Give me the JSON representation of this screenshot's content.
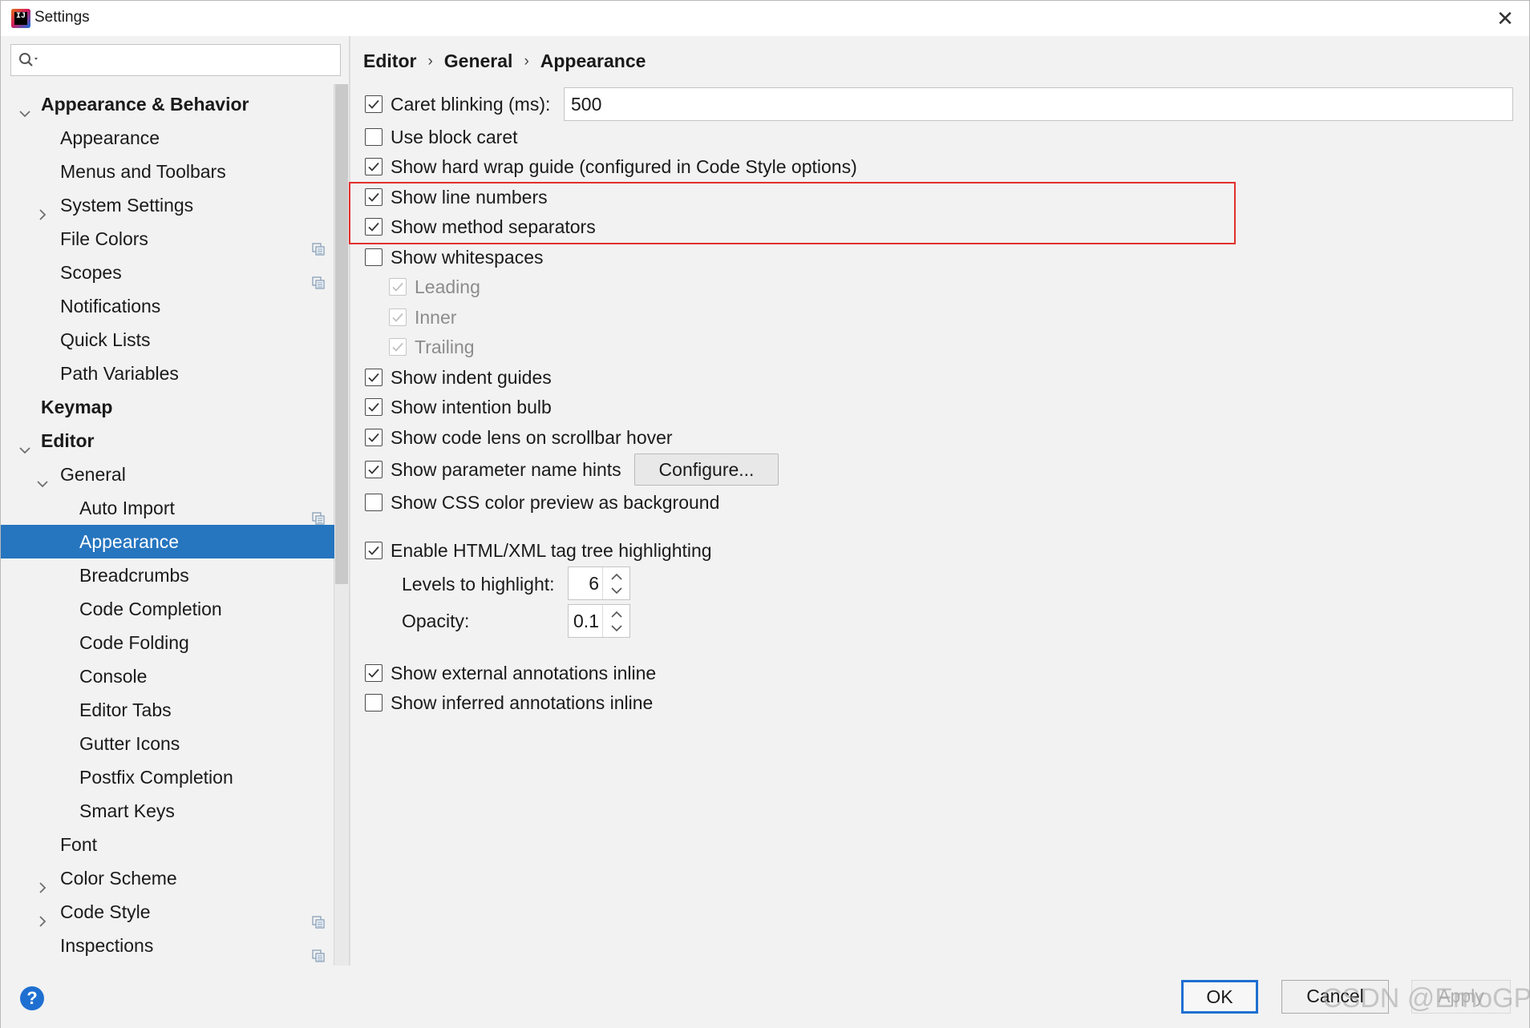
{
  "window": {
    "title": "Settings",
    "close_glyph": "✕",
    "app_icon_letters": "IJ"
  },
  "sidebar": {
    "search_placeholder": "",
    "items": [
      {
        "label": "Appearance & Behavior",
        "indent": 0,
        "bold": true,
        "arrow": "down",
        "project_icon": false
      },
      {
        "label": "Appearance",
        "indent": 1,
        "bold": false,
        "arrow": "none",
        "project_icon": false
      },
      {
        "label": "Menus and Toolbars",
        "indent": 1,
        "bold": false,
        "arrow": "none",
        "project_icon": false
      },
      {
        "label": "System Settings",
        "indent": 1,
        "bold": false,
        "arrow": "right",
        "project_icon": false
      },
      {
        "label": "File Colors",
        "indent": 1,
        "bold": false,
        "arrow": "none",
        "project_icon": true
      },
      {
        "label": "Scopes",
        "indent": 1,
        "bold": false,
        "arrow": "none",
        "project_icon": true
      },
      {
        "label": "Notifications",
        "indent": 1,
        "bold": false,
        "arrow": "none",
        "project_icon": false
      },
      {
        "label": "Quick Lists",
        "indent": 1,
        "bold": false,
        "arrow": "none",
        "project_icon": false
      },
      {
        "label": "Path Variables",
        "indent": 1,
        "bold": false,
        "arrow": "none",
        "project_icon": false
      },
      {
        "label": "Keymap",
        "indent": 0,
        "bold": true,
        "arrow": "none",
        "project_icon": false
      },
      {
        "label": "Editor",
        "indent": 0,
        "bold": true,
        "arrow": "down",
        "project_icon": false
      },
      {
        "label": "General",
        "indent": 1,
        "bold": false,
        "arrow": "down",
        "project_icon": false
      },
      {
        "label": "Auto Import",
        "indent": 2,
        "bold": false,
        "arrow": "none",
        "project_icon": true
      },
      {
        "label": "Appearance",
        "indent": 2,
        "bold": false,
        "arrow": "none",
        "project_icon": false,
        "selected": true
      },
      {
        "label": "Breadcrumbs",
        "indent": 2,
        "bold": false,
        "arrow": "none",
        "project_icon": false
      },
      {
        "label": "Code Completion",
        "indent": 2,
        "bold": false,
        "arrow": "none",
        "project_icon": false
      },
      {
        "label": "Code Folding",
        "indent": 2,
        "bold": false,
        "arrow": "none",
        "project_icon": false
      },
      {
        "label": "Console",
        "indent": 2,
        "bold": false,
        "arrow": "none",
        "project_icon": false
      },
      {
        "label": "Editor Tabs",
        "indent": 2,
        "bold": false,
        "arrow": "none",
        "project_icon": false
      },
      {
        "label": "Gutter Icons",
        "indent": 2,
        "bold": false,
        "arrow": "none",
        "project_icon": false
      },
      {
        "label": "Postfix Completion",
        "indent": 2,
        "bold": false,
        "arrow": "none",
        "project_icon": false
      },
      {
        "label": "Smart Keys",
        "indent": 2,
        "bold": false,
        "arrow": "none",
        "project_icon": false
      },
      {
        "label": "Font",
        "indent": 1,
        "bold": false,
        "arrow": "none",
        "project_icon": false
      },
      {
        "label": "Color Scheme",
        "indent": 1,
        "bold": false,
        "arrow": "right",
        "project_icon": false
      },
      {
        "label": "Code Style",
        "indent": 1,
        "bold": false,
        "arrow": "right",
        "project_icon": true
      },
      {
        "label": "Inspections",
        "indent": 1,
        "bold": false,
        "arrow": "none",
        "project_icon": true
      }
    ]
  },
  "breadcrumb": [
    "Editor",
    "General",
    "Appearance"
  ],
  "breadcrumb_separator": "›",
  "options": {
    "caret_blinking": {
      "label": "Caret blinking (ms):",
      "checked": true,
      "value": "500"
    },
    "use_block_caret": {
      "label": "Use block caret",
      "checked": false
    },
    "hard_wrap_guide": {
      "label": "Show hard wrap guide (configured in Code Style options)",
      "checked": true
    },
    "line_numbers": {
      "label": "Show line numbers",
      "checked": true
    },
    "method_separators": {
      "label": "Show method separators",
      "checked": true
    },
    "whitespaces": {
      "label": "Show whitespaces",
      "checked": false
    },
    "leading": {
      "label": "Leading",
      "checked": true,
      "disabled": true
    },
    "inner": {
      "label": "Inner",
      "checked": true,
      "disabled": true
    },
    "trailing": {
      "label": "Trailing",
      "checked": true,
      "disabled": true
    },
    "indent_guides": {
      "label": "Show indent guides",
      "checked": true
    },
    "intention_bulb": {
      "label": "Show intention bulb",
      "checked": true
    },
    "code_lens": {
      "label": "Show code lens on scrollbar hover",
      "checked": true
    },
    "param_hints": {
      "label": "Show parameter name hints",
      "checked": true,
      "button": "Configure..."
    },
    "css_color_preview": {
      "label": "Show CSS color preview as background",
      "checked": false
    },
    "tag_tree_highlighting": {
      "label": "Enable HTML/XML tag tree highlighting",
      "checked": true
    },
    "levels_to_highlight": {
      "label": "Levels to highlight:",
      "value": "6"
    },
    "opacity": {
      "label": "Opacity:",
      "value": "0.1"
    },
    "external_annotations": {
      "label": "Show external annotations inline",
      "checked": true
    },
    "inferred_annotations": {
      "label": "Show inferred annotations inline",
      "checked": false
    }
  },
  "footer": {
    "help_glyph": "?",
    "ok_label": "OK",
    "cancel_label": "Cancel",
    "apply_label": "Apply"
  },
  "watermark": "CSDN @ErnoGP",
  "colors": {
    "selection": "#2675bf",
    "highlight_box": "#e0312d",
    "primary_button_border": "#1f6fd1"
  }
}
